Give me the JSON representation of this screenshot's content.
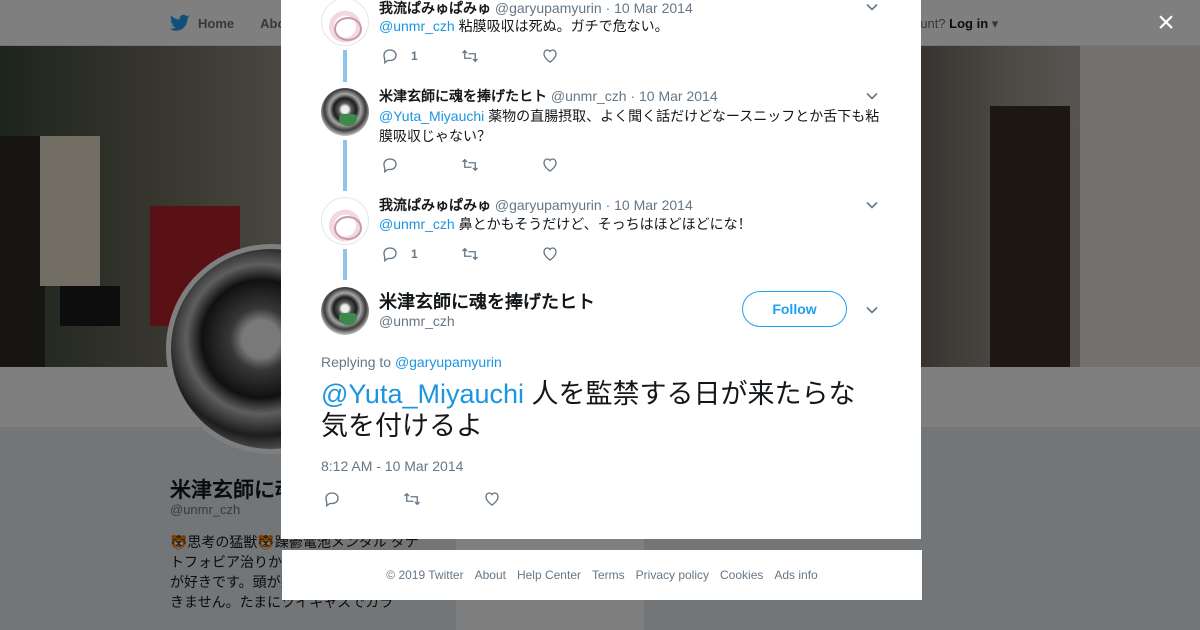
{
  "topbar": {
    "home_label": "Home",
    "about_label": "Abo",
    "account_prompt": "ccount?",
    "login_label": "Log in"
  },
  "profile": {
    "name": "米津玄師に魂",
    "handle": "@unmr_czh",
    "bio": "🐯思考の猛獣🐯躁鬱電池メンタル タナトフォビア治りか 米津玄師、VOCA などが好きです。頭が悪いので難しい話はできません。たまにツイキャスでカラ",
    "card_text": "Ads info"
  },
  "modal": {
    "replies": [
      {
        "name": "我流ぱみゅぱみゅ",
        "handle": "@garyupamyurin",
        "date": "· 10 Mar 2014",
        "mention": "@unmr_czh",
        "text": " 粘膜吸収は死ぬ。ガチで危ない。",
        "reply_count": "1",
        "retweet_count": "",
        "like_count": ""
      },
      {
        "name": "米津玄師に魂を捧げたヒト",
        "handle": "@unmr_czh",
        "date": "· 10 Mar 2014",
        "mention": "@Yuta_Miyauchi",
        "text": " 薬物の直腸摂取、よく聞く話だけどなースニッフとか舌下も粘膜吸収じゃない？",
        "reply_count": "",
        "retweet_count": "",
        "like_count": ""
      },
      {
        "name": "我流ぱみゅぱみゅ",
        "handle": "@garyupamyurin",
        "date": "· 10 Mar 2014",
        "mention": "@unmr_czh",
        "text": " 鼻とかもそうだけど、そっちはほどほどにな！",
        "reply_count": "1",
        "retweet_count": "",
        "like_count": ""
      }
    ],
    "main": {
      "name": "米津玄師に魂を捧げたヒト",
      "handle": "@unmr_czh",
      "follow_label": "Follow",
      "replying_prefix": "Replying to ",
      "replying_to": "@garyupamyurin",
      "mention": "@Yuta_Miyauchi",
      "text": " 人を監禁する日が来たらな気を付けるよ",
      "timestamp": "8:12 AM - 10 Mar 2014"
    }
  },
  "footer": {
    "copyright": "© 2019 Twitter",
    "links": [
      "About",
      "Help Center",
      "Terms",
      "Privacy policy",
      "Cookies",
      "Ads info"
    ]
  },
  "icons": {
    "close": "×",
    "chevron": "chevron-down-icon",
    "reply": "reply-icon",
    "retweet": "retweet-icon",
    "like": "heart-icon"
  },
  "colors": {
    "accent": "#1da1f2",
    "mention": "#1b95e0",
    "thread_line": "#8ec5ef",
    "muted": "#657786"
  }
}
